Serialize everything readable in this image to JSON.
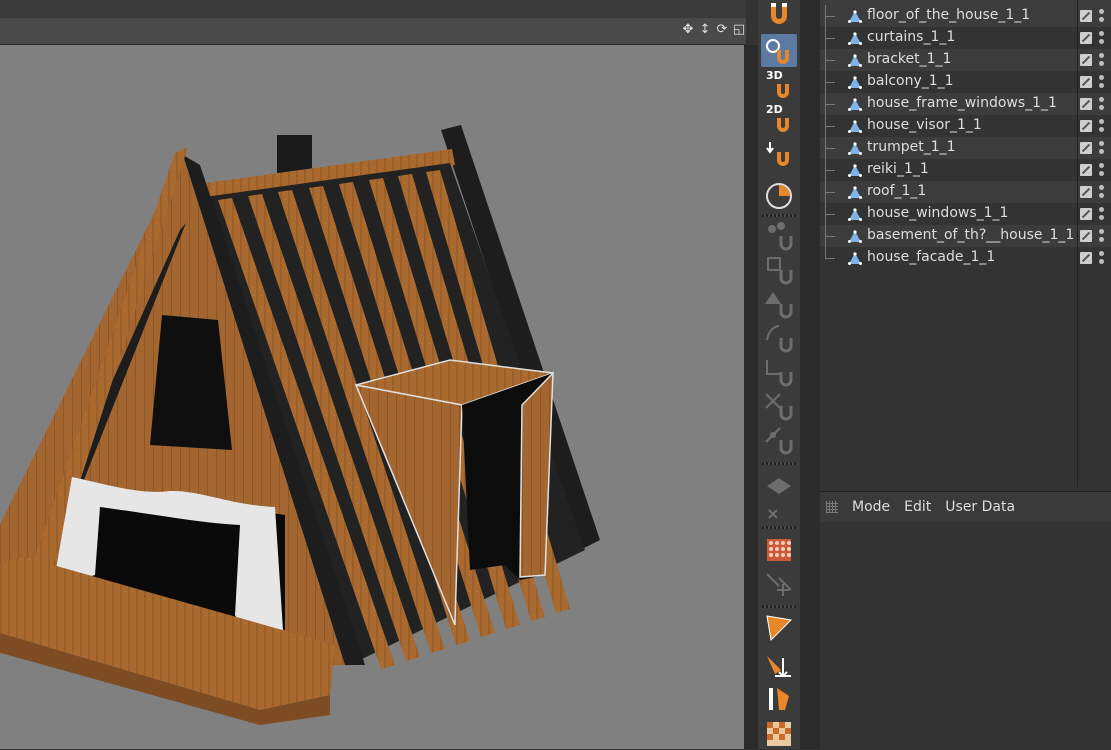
{
  "viewport": {
    "nav_icons": [
      "move-icon",
      "zoom-icon",
      "rotate-icon",
      "maximize-icon"
    ],
    "background_color": "#808080"
  },
  "toolbar": {
    "tools": [
      {
        "name": "snap-magnet-icon",
        "label": ""
      },
      {
        "name": "snap-enable-icon",
        "label": ""
      },
      {
        "name": "3d-snap-icon",
        "label": "3D"
      },
      {
        "name": "2d-snap-icon",
        "label": "2D"
      },
      {
        "name": "snap-down-icon",
        "label": ""
      },
      {
        "name": "quantize-icon",
        "label": ""
      },
      {
        "name": "vertex-snap-icon",
        "label": ""
      },
      {
        "name": "edge-snap-icon",
        "label": ""
      },
      {
        "name": "polygon-snap-icon",
        "label": ""
      },
      {
        "name": "spline-snap-icon",
        "label": ""
      },
      {
        "name": "axis-snap-icon",
        "label": ""
      },
      {
        "name": "intersection-snap-icon",
        "label": ""
      },
      {
        "name": "midpoint-snap-icon",
        "label": ""
      },
      {
        "name": "workplane-snap-icon",
        "label": ""
      },
      {
        "name": "grid-point-icon",
        "label": ""
      },
      {
        "name": "guide-snap-icon",
        "label": ""
      },
      {
        "name": "dynamic-guide-icon",
        "label": ""
      },
      {
        "name": "perpendicular-icon",
        "label": ""
      },
      {
        "name": "grid-material-icon",
        "label": ""
      }
    ],
    "active_tool_index": 1
  },
  "object_manager": {
    "objects": [
      {
        "name": "floor_of_the_house_1_1"
      },
      {
        "name": "curtains_1_1"
      },
      {
        "name": "bracket_1_1"
      },
      {
        "name": "balcony_1_1"
      },
      {
        "name": "house_frame_windows_1_1"
      },
      {
        "name": "house_visor_1_1"
      },
      {
        "name": "trumpet_1_1"
      },
      {
        "name": "reiki_1_1"
      },
      {
        "name": "roof_1_1"
      },
      {
        "name": "house_windows_1_1"
      },
      {
        "name": "basement_of_th?__house_1_1"
      },
      {
        "name": "house_facade_1_1"
      }
    ]
  },
  "attributes": {
    "menu": [
      "Mode",
      "Edit",
      "User Data"
    ]
  },
  "colors": {
    "accent_orange": "#e8872a",
    "active_tool": "#5d7aa3",
    "wood": "#a86a35",
    "roof_dark": "#1c1c1c"
  }
}
